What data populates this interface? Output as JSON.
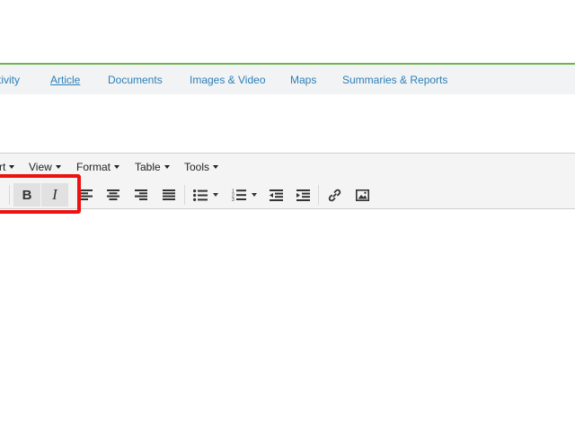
{
  "nav": {
    "tabs": [
      {
        "label": "tivity"
      },
      {
        "label": "Article"
      },
      {
        "label": "Documents"
      },
      {
        "label": "Images & Video"
      },
      {
        "label": "Maps"
      },
      {
        "label": "Summaries & Reports"
      }
    ]
  },
  "editor": {
    "menus": [
      {
        "label": "rt"
      },
      {
        "label": "View"
      },
      {
        "label": "Format"
      },
      {
        "label": "Table"
      },
      {
        "label": "Tools"
      }
    ],
    "toolbar": {
      "bold_label": "B",
      "italic_label": "I",
      "icons": [
        "align-left-icon",
        "align-center-icon",
        "align-right-icon",
        "align-justify-icon",
        "bullet-list-icon",
        "numbered-list-icon",
        "outdent-icon",
        "indent-icon",
        "link-icon",
        "image-icon"
      ]
    }
  },
  "colors": {
    "accent_line": "#6fb34f",
    "nav_link": "#2f7fb5",
    "highlight": "#ee1111"
  }
}
